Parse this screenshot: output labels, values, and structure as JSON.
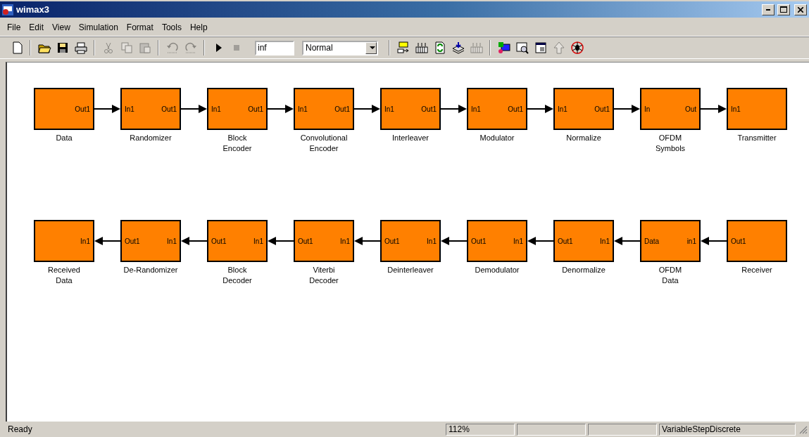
{
  "window": {
    "title": "wimax3"
  },
  "menu": [
    "File",
    "Edit",
    "View",
    "Simulation",
    "Format",
    "Tools",
    "Help"
  ],
  "toolbar": {
    "buttons": [
      {
        "disabled": false
      },
      {
        "disabled": false
      },
      {
        "disabled": false
      },
      {
        "disabled": false
      },
      {
        "disabled": true
      },
      {
        "disabled": true
      },
      {
        "disabled": true
      },
      {
        "disabled": true
      },
      {
        "disabled": true
      },
      {
        "disabled": false
      },
      {
        "disabled": true
      }
    ],
    "stop_time": "inf",
    "mode": "Normal",
    "tools": [
      {
        "disabled": false
      },
      {
        "disabled": false
      },
      {
        "disabled": false
      },
      {
        "disabled": false
      },
      {
        "disabled": true
      },
      {
        "disabled": false
      },
      {
        "disabled": false
      },
      {
        "disabled": false
      },
      {
        "disabled": true
      },
      {
        "disabled": false
      }
    ]
  },
  "rows": [
    {
      "kind": "forward",
      "blocks": [
        {
          "name": "Data",
          "right_port": "Out1"
        },
        {
          "name": "Randomizer",
          "left_port": "In1",
          "right_port": "Out1"
        },
        {
          "name": "Block\nEncoder",
          "left_port": "In1",
          "right_port": "Out1"
        },
        {
          "name": "Convolutional\nEncoder",
          "left_port": "In1",
          "right_port": "Out1"
        },
        {
          "name": "Interleaver",
          "left_port": "In1",
          "right_port": "Out1"
        },
        {
          "name": "Modulator",
          "left_port": "In1",
          "right_port": "Out1"
        },
        {
          "name": "Normalize",
          "left_port": "In1",
          "right_port": "Out1"
        },
        {
          "name": "OFDM\nSymbols",
          "left_port": "In",
          "right_port": "Out"
        },
        {
          "name": "Transmitter",
          "left_port": "In1"
        }
      ]
    },
    {
      "kind": "backward",
      "blocks": [
        {
          "name": "Received\nData",
          "right_port": "In1"
        },
        {
          "name": "De-Randomizer",
          "left_port": "Out1",
          "right_port": "In1"
        },
        {
          "name": "Block\nDecoder",
          "left_port": "Out1",
          "right_port": "In1"
        },
        {
          "name": "Viterbi\nDecoder",
          "left_port": "Out1",
          "right_port": "In1"
        },
        {
          "name": "Deinterleaver",
          "left_port": "Out1",
          "right_port": "In1"
        },
        {
          "name": "Demodulator",
          "left_port": "Out1",
          "right_port": "In1"
        },
        {
          "name": "Denormalize",
          "left_port": "Out1",
          "right_port": "In1"
        },
        {
          "name": "OFDM\nData",
          "left_port": "Data",
          "right_port": "in1"
        },
        {
          "name": "Receiver",
          "left_port": "Out1"
        }
      ]
    }
  ],
  "status_bar": {
    "message": "Ready",
    "zoom": "112%",
    "solver": "VariableStepDiscrete"
  }
}
